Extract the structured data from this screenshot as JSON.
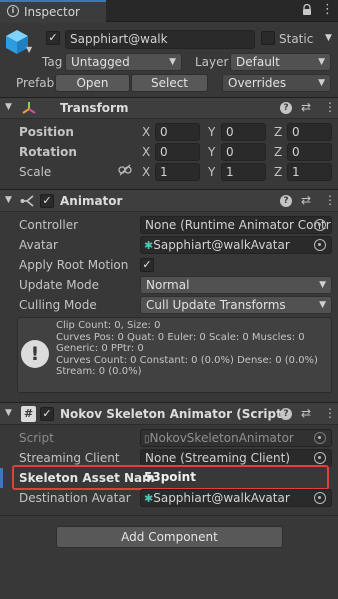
{
  "tab": {
    "title": "Inspector"
  },
  "header": {
    "object_name": "Sapphiart@walk",
    "static_label": "Static",
    "tag_label": "Tag",
    "tag_value": "Untagged",
    "layer_label": "Layer",
    "layer_value": "Default",
    "prefab_label": "Prefab",
    "open_label": "Open",
    "select_label": "Select",
    "overrides_label": "Overrides"
  },
  "transform": {
    "title": "Transform",
    "position_label": "Position",
    "rotation_label": "Rotation",
    "scale_label": "Scale",
    "x": "X",
    "y": "Y",
    "z": "Z",
    "position": [
      "0",
      "0",
      "0"
    ],
    "rotation": [
      "0",
      "0",
      "0"
    ],
    "scale": [
      "1",
      "1",
      "1"
    ]
  },
  "animator": {
    "title": "Animator",
    "controller_label": "Controller",
    "controller_value": "None (Runtime Animator Controller)",
    "avatar_label": "Avatar",
    "avatar_value": "Sapphiart@walkAvatar",
    "root_motion_label": "Apply Root Motion",
    "update_mode_label": "Update Mode",
    "update_mode_value": "Normal",
    "culling_mode_label": "Culling Mode",
    "culling_mode_value": "Cull Update Transforms",
    "info_lines": [
      "Clip Count: 0, Size: 0",
      "Curves Pos: 0 Quat: 0 Euler: 0 Scale: 0 Muscles: 0",
      "Generic: 0 PPtr: 0",
      "Curves Count: 0 Constant: 0 (0.0%) Dense: 0 (0.0%)",
      "Stream: 0 (0.0%)"
    ]
  },
  "nokov": {
    "title": "Nokov Skeleton Animator (Script)",
    "script_label": "Script",
    "script_value": "NokovSkeletonAnimator",
    "client_label": "Streaming Client",
    "client_value": "None (Streaming Client)",
    "asset_label": "Skeleton Asset Nam",
    "asset_value": "53point",
    "dest_label": "Destination Avatar",
    "dest_value": "Sapphiart@walkAvatar"
  },
  "footer": {
    "add_component_label": "Add Component"
  },
  "colors": {
    "highlight": "#e0413a",
    "accent": "#3a79bb",
    "panel": "#383838"
  }
}
